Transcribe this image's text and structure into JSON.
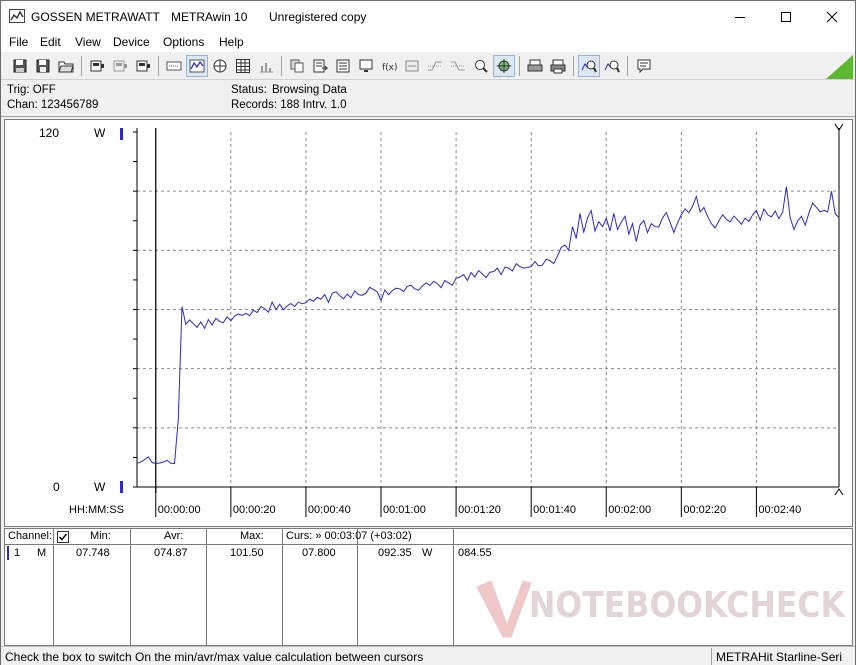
{
  "window": {
    "brand": "GOSSEN METRAWATT",
    "app_name": "METRAwin 10",
    "license": "Unregistered copy",
    "minimize_icon": "minimize-icon",
    "maximize_icon": "maximize-icon",
    "close_icon": "close-icon"
  },
  "menu": {
    "items": [
      {
        "label": "File"
      },
      {
        "label": "Edit"
      },
      {
        "label": "View"
      },
      {
        "label": "Device"
      },
      {
        "label": "Options"
      },
      {
        "label": "Help"
      }
    ]
  },
  "info": {
    "trig": "Trig: OFF",
    "chan": "Chan:  123456789",
    "status_label": "Status:",
    "status_value": "Browsing Data",
    "records": "Records: 188  Intrv. 1.0"
  },
  "chart_data": {
    "type": "line",
    "y_top_label": "120",
    "y_bottom_label": "0",
    "y_unit": "W",
    "ylim": [
      0,
      120
    ],
    "x_axis_label": "HH:MM:SS",
    "x_ticks": [
      "00:00:00",
      "00:00:20",
      "00:00:40",
      "00:01:00",
      "00:01:20",
      "00:01:40",
      "00:02:00",
      "00:02:20",
      "00:02:40"
    ],
    "xlim": [
      -5,
      182
    ],
    "grid": true,
    "line_color": "#2a2ac8",
    "series": [
      {
        "values": [
          [
            -5,
            8.0
          ],
          [
            -4,
            8.4
          ],
          [
            -3,
            9.2
          ],
          [
            -2,
            10.2
          ],
          [
            -1,
            8.3
          ],
          [
            0,
            7.9
          ],
          [
            1,
            8.1
          ],
          [
            2,
            8.4
          ],
          [
            3,
            9.0
          ],
          [
            4,
            8.0
          ],
          [
            5,
            7.9
          ],
          [
            6,
            23.0
          ],
          [
            7,
            61.0
          ],
          [
            8,
            55.0
          ],
          [
            9,
            56.5
          ],
          [
            10,
            55.2
          ],
          [
            11,
            54.0
          ],
          [
            12,
            55.8
          ],
          [
            13,
            53.6
          ],
          [
            14,
            56.6
          ],
          [
            15,
            54.8
          ],
          [
            16,
            57.0
          ],
          [
            17,
            56.0
          ],
          [
            18,
            55.5
          ],
          [
            19,
            57.5
          ],
          [
            20,
            56.2
          ],
          [
            21,
            57.8
          ],
          [
            22,
            58.5
          ],
          [
            23,
            58.0
          ],
          [
            24,
            58.7
          ],
          [
            25,
            57.9
          ],
          [
            26,
            59.8
          ],
          [
            27,
            59.0
          ],
          [
            28,
            61.0
          ],
          [
            29,
            60.3
          ],
          [
            30,
            59.1
          ],
          [
            31,
            62.5
          ],
          [
            32,
            60.0
          ],
          [
            33,
            61.8
          ],
          [
            34,
            59.9
          ],
          [
            35,
            61.2
          ],
          [
            36,
            62.0
          ],
          [
            37,
            61.0
          ],
          [
            38,
            62.5
          ],
          [
            39,
            61.9
          ],
          [
            40,
            62.3
          ],
          [
            41,
            63.5
          ],
          [
            42,
            62.8
          ],
          [
            43,
            64.1
          ],
          [
            44,
            63.5
          ],
          [
            45,
            65.0
          ],
          [
            46,
            62.4
          ],
          [
            47,
            65.5
          ],
          [
            48,
            66.0
          ],
          [
            49,
            64.7
          ],
          [
            50,
            63.6
          ],
          [
            51,
            65.2
          ],
          [
            52,
            64.0
          ],
          [
            53,
            66.3
          ],
          [
            54,
            65.0
          ],
          [
            55,
            64.8
          ],
          [
            56,
            65.5
          ],
          [
            57,
            67.5
          ],
          [
            58,
            66.8
          ],
          [
            59,
            65.9
          ],
          [
            60,
            63.0
          ],
          [
            61,
            66.6
          ],
          [
            62,
            65.0
          ],
          [
            63,
            66.4
          ],
          [
            64,
            67.2
          ],
          [
            65,
            67.0
          ],
          [
            66,
            66.0
          ],
          [
            67,
            67.8
          ],
          [
            68,
            68.2
          ],
          [
            69,
            67.0
          ],
          [
            70,
            66.5
          ],
          [
            71,
            67.9
          ],
          [
            72,
            69.0
          ],
          [
            73,
            68.1
          ],
          [
            74,
            69.5
          ],
          [
            75,
            68.8
          ],
          [
            76,
            67.4
          ],
          [
            77,
            69.8
          ],
          [
            78,
            69.0
          ],
          [
            79,
            68.2
          ],
          [
            80,
            70.5
          ],
          [
            81,
            71.0
          ],
          [
            82,
            71.8
          ],
          [
            83,
            69.8
          ],
          [
            84,
            72.5
          ],
          [
            85,
            71.0
          ],
          [
            86,
            73.2
          ],
          [
            87,
            72.0
          ],
          [
            88,
            70.8
          ],
          [
            89,
            72.6
          ],
          [
            90,
            72.8
          ],
          [
            91,
            74.0
          ],
          [
            92,
            71.8
          ],
          [
            93,
            74.3
          ],
          [
            94,
            74.0
          ],
          [
            95,
            73.0
          ],
          [
            96,
            75.5
          ],
          [
            97,
            74.5
          ],
          [
            98,
            74.0
          ],
          [
            99,
            74.2
          ],
          [
            100,
            74.5
          ],
          [
            101,
            76.2
          ],
          [
            102,
            74.7
          ],
          [
            103,
            75.0
          ],
          [
            104,
            77.0
          ],
          [
            105,
            76.5
          ],
          [
            106,
            75.5
          ],
          [
            107,
            78.0
          ],
          [
            108,
            81.0
          ],
          [
            109,
            81.8
          ],
          [
            110,
            80.0
          ],
          [
            111,
            88.0
          ],
          [
            112,
            84.0
          ],
          [
            113,
            92.5
          ],
          [
            114,
            86.0
          ],
          [
            115,
            91.0
          ],
          [
            116,
            93.4
          ],
          [
            117,
            86.5
          ],
          [
            118,
            89.7
          ],
          [
            119,
            88.0
          ],
          [
            120,
            90.8
          ],
          [
            121,
            86.6
          ],
          [
            122,
            92.5
          ],
          [
            123,
            87.0
          ],
          [
            124,
            89.5
          ],
          [
            125,
            91.5
          ],
          [
            126,
            85.5
          ],
          [
            127,
            89.0
          ],
          [
            128,
            83.0
          ],
          [
            129,
            88.6
          ],
          [
            130,
            90.1
          ],
          [
            131,
            86.0
          ],
          [
            132,
            89.0
          ],
          [
            133,
            88.0
          ],
          [
            134,
            87.9
          ],
          [
            135,
            91.0
          ],
          [
            136,
            92.8
          ],
          [
            137,
            89.5
          ],
          [
            138,
            86.0
          ],
          [
            139,
            89.3
          ],
          [
            140,
            92.0
          ],
          [
            141,
            94.0
          ],
          [
            142,
            92.7
          ],
          [
            143,
            95.0
          ],
          [
            144,
            98.2
          ],
          [
            145,
            93.0
          ],
          [
            146,
            94.5
          ],
          [
            147,
            91.5
          ],
          [
            148,
            89.0
          ],
          [
            149,
            87.5
          ],
          [
            150,
            90.0
          ],
          [
            151,
            92.0
          ],
          [
            152,
            90.5
          ],
          [
            153,
            89.6
          ],
          [
            154,
            91.6
          ],
          [
            155,
            90.3
          ],
          [
            156,
            88.8
          ],
          [
            157,
            90.9
          ],
          [
            158,
            89.8
          ],
          [
            159,
            92.0
          ],
          [
            160,
            93.5
          ],
          [
            161,
            90.2
          ],
          [
            162,
            94.0
          ],
          [
            163,
            92.0
          ],
          [
            164,
            91.3
          ],
          [
            165,
            93.3
          ],
          [
            166,
            90.7
          ],
          [
            167,
            93.0
          ],
          [
            168,
            101.5
          ],
          [
            169,
            91.0
          ],
          [
            170,
            87.0
          ],
          [
            171,
            90.0
          ],
          [
            172,
            91.5
          ],
          [
            173,
            88.5
          ],
          [
            174,
            92.7
          ],
          [
            175,
            96.0
          ],
          [
            176,
            94.5
          ],
          [
            177,
            93.0
          ],
          [
            178,
            93.5
          ],
          [
            179,
            93.0
          ],
          [
            180,
            100.0
          ],
          [
            181,
            92.4
          ],
          [
            182,
            91.0
          ]
        ]
      }
    ]
  },
  "stats": {
    "channel_hdr": "Channel:",
    "checkbox_checked": true,
    "min_hdr": "Min:",
    "avr_hdr": "Avr:",
    "max_hdr": "Max:",
    "curs_hdr": "Curs: » 00:03:07 (+03:02)",
    "row_channel": "1",
    "row_unit_code": "M",
    "row_min": "07.748",
    "row_avr": "074.87",
    "row_max": "101.50",
    "row_curs1": "07.800",
    "row_curs2": "092.35",
    "row_curs_unit": "W",
    "row_curs3": "084.55"
  },
  "watermark": {
    "text": "NOTEBOOKCHECK"
  },
  "statusbar": {
    "hint": "Check the box to switch On the min/avr/max value calculation between cursors",
    "device": "METRAHit Starline-Seri"
  }
}
